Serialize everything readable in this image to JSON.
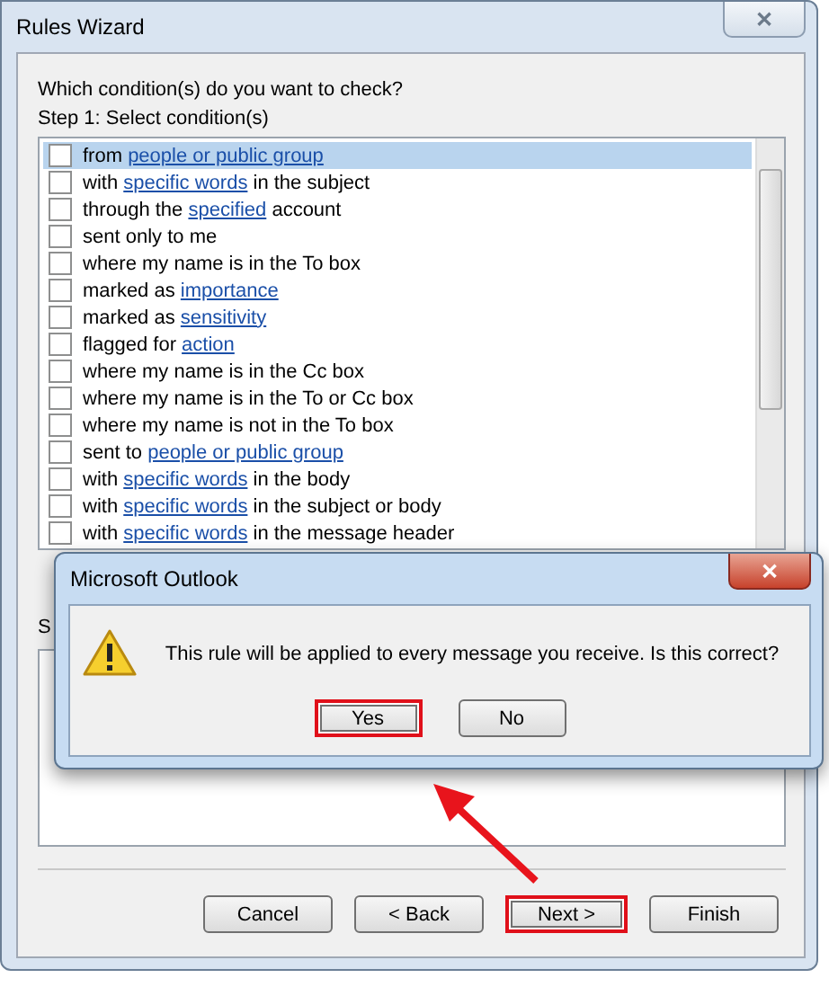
{
  "window": {
    "title": "Rules Wizard",
    "close": "✕"
  },
  "prompt": "Which condition(s) do you want to check?",
  "step1_label": "Step 1: Select condition(s)",
  "conditions": [
    {
      "checked": false,
      "selected": true,
      "parts": [
        {
          "text": "from "
        },
        {
          "text": "people or public group",
          "link": true
        }
      ]
    },
    {
      "checked": false,
      "selected": false,
      "parts": [
        {
          "text": "with "
        },
        {
          "text": "specific words",
          "link": true
        },
        {
          "text": " in the subject"
        }
      ]
    },
    {
      "checked": false,
      "selected": false,
      "parts": [
        {
          "text": "through the "
        },
        {
          "text": "specified",
          "link": true
        },
        {
          "text": " account"
        }
      ]
    },
    {
      "checked": false,
      "selected": false,
      "parts": [
        {
          "text": "sent only to me"
        }
      ]
    },
    {
      "checked": false,
      "selected": false,
      "parts": [
        {
          "text": "where my name is in the To box"
        }
      ]
    },
    {
      "checked": false,
      "selected": false,
      "parts": [
        {
          "text": "marked as "
        },
        {
          "text": "importance",
          "link": true
        }
      ]
    },
    {
      "checked": false,
      "selected": false,
      "parts": [
        {
          "text": "marked as "
        },
        {
          "text": "sensitivity",
          "link": true
        }
      ]
    },
    {
      "checked": false,
      "selected": false,
      "parts": [
        {
          "text": "flagged for "
        },
        {
          "text": "action",
          "link": true
        }
      ]
    },
    {
      "checked": false,
      "selected": false,
      "parts": [
        {
          "text": "where my name is in the Cc box"
        }
      ]
    },
    {
      "checked": false,
      "selected": false,
      "parts": [
        {
          "text": "where my name is in the To or Cc box"
        }
      ]
    },
    {
      "checked": false,
      "selected": false,
      "parts": [
        {
          "text": "where my name is not in the To box"
        }
      ]
    },
    {
      "checked": false,
      "selected": false,
      "parts": [
        {
          "text": "sent to "
        },
        {
          "text": "people or public group",
          "link": true
        }
      ]
    },
    {
      "checked": false,
      "selected": false,
      "parts": [
        {
          "text": "with "
        },
        {
          "text": "specific words",
          "link": true
        },
        {
          "text": " in the body"
        }
      ]
    },
    {
      "checked": false,
      "selected": false,
      "parts": [
        {
          "text": "with "
        },
        {
          "text": "specific words",
          "link": true
        },
        {
          "text": " in the subject or body"
        }
      ]
    },
    {
      "checked": false,
      "selected": false,
      "parts": [
        {
          "text": "with "
        },
        {
          "text": "specific words",
          "link": true
        },
        {
          "text": " in the message header"
        }
      ]
    }
  ],
  "step2_label": "S",
  "buttons": [
    {
      "label": "Cancel",
      "highlighted": false
    },
    {
      "label": "< Back",
      "highlighted": false
    },
    {
      "label": "Next >",
      "highlighted": true
    },
    {
      "label": "Finish",
      "highlighted": false
    }
  ],
  "dialog": {
    "title": "Microsoft Outlook",
    "close": "✕",
    "message": "This rule will be applied to every message you receive. Is this correct?",
    "buttons": [
      {
        "label": "Yes",
        "highlighted": true
      },
      {
        "label": "No",
        "highlighted": false
      }
    ]
  }
}
